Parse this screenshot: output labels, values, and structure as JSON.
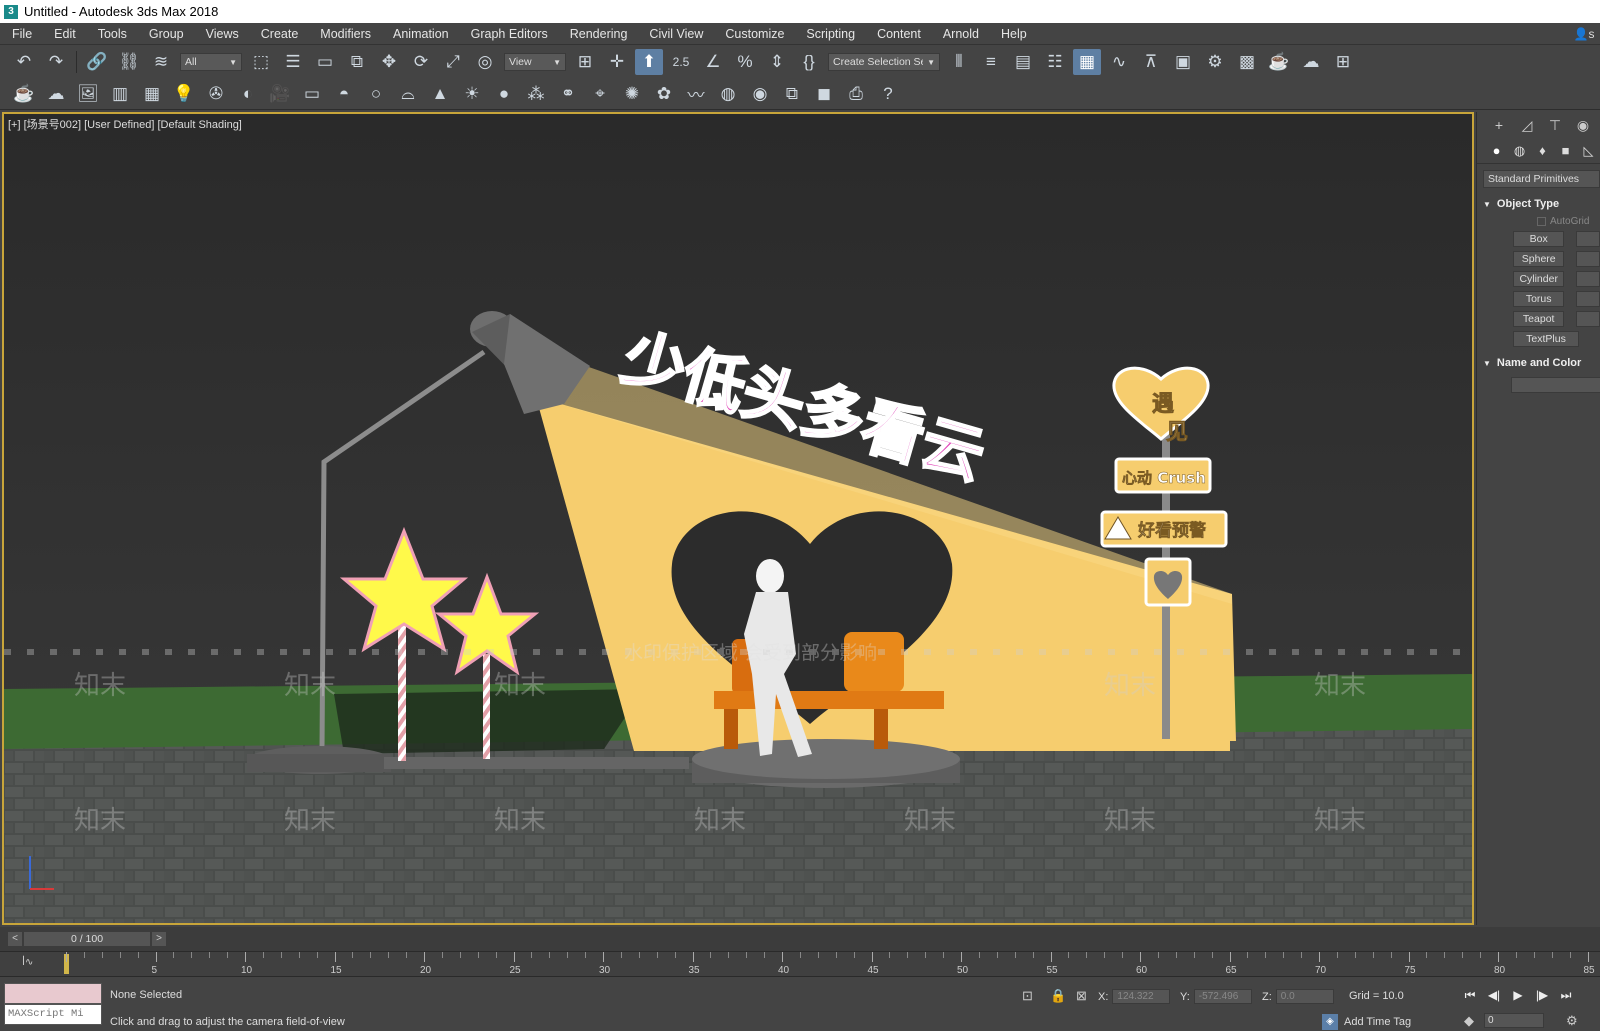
{
  "window": {
    "title": "Untitled - Autodesk 3ds Max 2018"
  },
  "menu": {
    "items": [
      "File",
      "Edit",
      "Tools",
      "Group",
      "Views",
      "Create",
      "Modifiers",
      "Animation",
      "Graph Editors",
      "Rendering",
      "Civil View",
      "Customize",
      "Scripting",
      "Content",
      "Arnold",
      "Help"
    ]
  },
  "account_label": "s",
  "toolbar": {
    "selection_filter": "All",
    "ref_coord": "View",
    "snap_label": "2.5",
    "named_selection": "Create Selection Set"
  },
  "viewport": {
    "label": "[+] [场景号002] [User Defined] [Default Shading]",
    "scene": {
      "title_text": "少低头多看云",
      "sign_heart_line1": "遇",
      "sign_heart_line2": "见",
      "sign_crush": "心动 Crush",
      "sign_warning": "好看预警",
      "watermark_center": "水印保护区域  会受到部分影响",
      "watermark_small": "知末"
    }
  },
  "command_panel": {
    "dropdown": "Standard Primitives",
    "object_type_header": "Object Type",
    "autogrid_label": "AutoGrid",
    "buttons": [
      "Box",
      "Sphere",
      "Cylinder",
      "Torus",
      "Teapot",
      "TextPlus"
    ],
    "name_color_header": "Name and Color"
  },
  "timeline": {
    "slider_label": "0 / 100",
    "prev": "<",
    "next": ">",
    "ruler_labels": [
      "5",
      "10",
      "15",
      "20",
      "25",
      "30",
      "35",
      "40",
      "45",
      "50",
      "55",
      "60",
      "65",
      "70",
      "75",
      "80",
      "85"
    ]
  },
  "status": {
    "maxscript": "MAXScript Mi",
    "selection": "None Selected",
    "prompt": "Click and drag to adjust the camera field-of-view",
    "x_label": "X:",
    "x_value": "124.322",
    "y_label": "Y:",
    "y_value": "-572.496",
    "z_label": "Z:",
    "z_value": "0.0",
    "grid": "Grid = 10.0",
    "add_time_tag": "Add Time Tag",
    "frame_value": "0"
  }
}
